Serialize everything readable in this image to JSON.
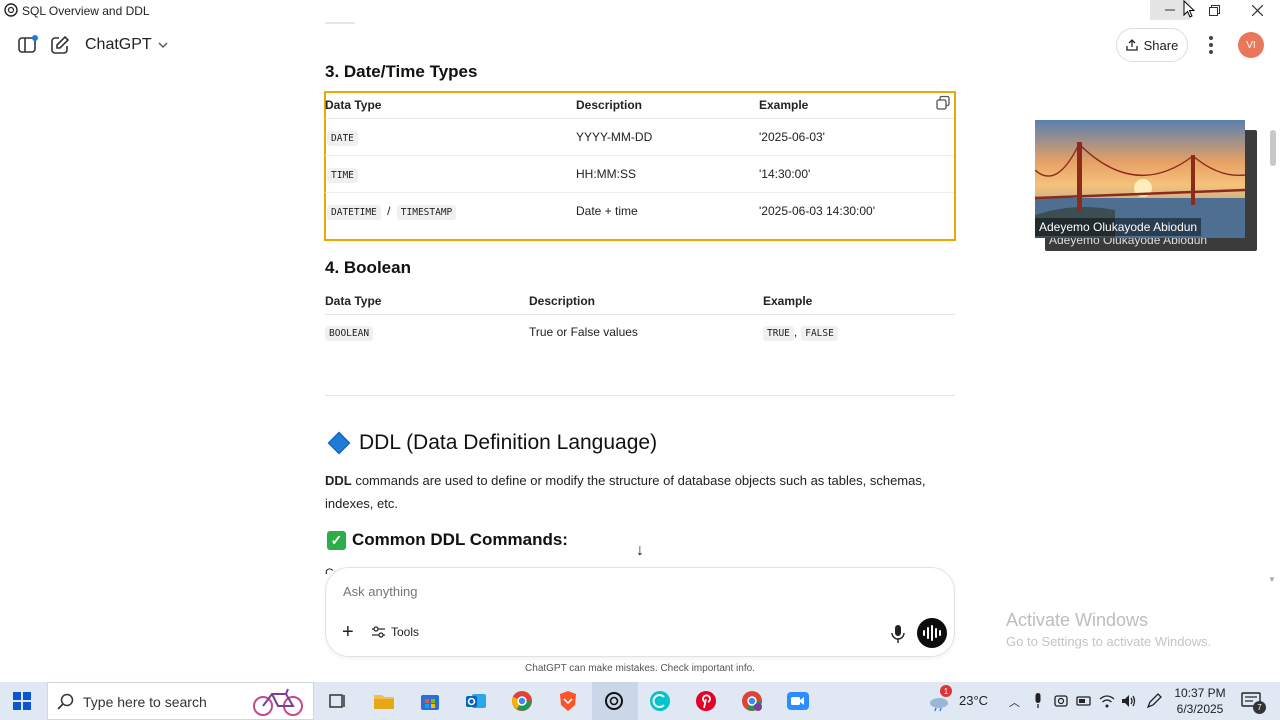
{
  "window": {
    "title": "SQL Overview and DDL"
  },
  "header": {
    "brand": "ChatGPT",
    "share_label": "Share",
    "avatar_initials": "VI"
  },
  "sections": {
    "datetime": {
      "heading": "3. Date/Time Types",
      "columns": [
        "Data Type",
        "Description",
        "Example"
      ],
      "rows": [
        {
          "type_parts": [
            "DATE"
          ],
          "description": "YYYY-MM-DD",
          "example": "'2025-06-03'"
        },
        {
          "type_parts": [
            "TIME"
          ],
          "description": "HH:MM:SS",
          "example": "'14:30:00'"
        },
        {
          "type_parts": [
            "DATETIME",
            "TIMESTAMP"
          ],
          "separator": "/",
          "description": "Date + time",
          "example": "'2025-06-03 14:30:00'"
        }
      ]
    },
    "boolean": {
      "heading": "4. Boolean",
      "columns": [
        "Data Type",
        "Description",
        "Example"
      ],
      "rows": [
        {
          "type": "BOOLEAN",
          "description": "True or False values",
          "example_parts": [
            "TRUE",
            "FALSE"
          ],
          "example_separator": ","
        }
      ]
    },
    "ddl": {
      "heading": "DDL (Data Definition Language)",
      "bold_term": "DDL",
      "paragraph": " commands are used to define or modify the structure of database objects such as tables, schemas, indexes, etc.",
      "common_heading": "Common DDL Commands:",
      "cut_text": "Co"
    }
  },
  "composer": {
    "placeholder": "Ask anything",
    "tools_label": "Tools"
  },
  "disclaimer": "ChatGPT can make mistakes. Check important info.",
  "video": {
    "participant": "Adeyemo Olukayode Abiodun"
  },
  "watermark": {
    "line1": "Activate Windows",
    "line2": "Go to Settings to activate Windows."
  },
  "taskbar": {
    "search_placeholder": "Type here to search",
    "weather": "23°C",
    "weather_badge": "1",
    "time": "10:37 PM",
    "date": "6/3/2025",
    "notification_count": "7"
  },
  "colors": {
    "highlight_border": "#f0a500",
    "accent_blue": "#1f7ad8",
    "check_green": "#2dac4a",
    "avatar": "#e9785b"
  }
}
